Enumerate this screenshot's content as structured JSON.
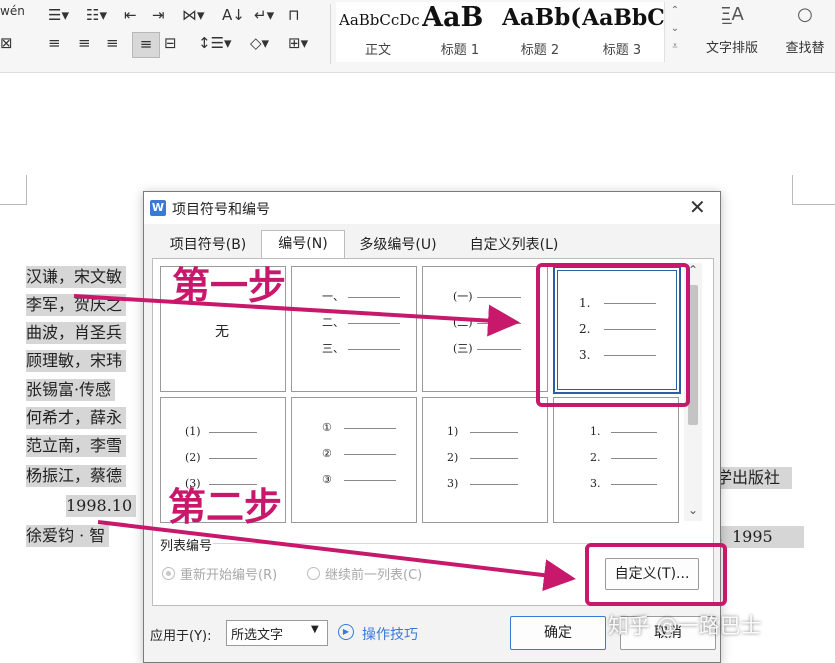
{
  "ribbon": {
    "font_label": "wén",
    "styles": [
      {
        "sample": "AaBbCcDc",
        "label": "正文"
      },
      {
        "sample": "AaB",
        "label": "标题 1"
      },
      {
        "sample": "AaBb(",
        "label": "标题 2"
      },
      {
        "sample": "AaBbC",
        "label": "标题 3"
      }
    ],
    "text_layout_label": "文字排版",
    "find_label": "查找替"
  },
  "document": {
    "lines": [
      "汉谦，宋文敏",
      "李军，贺庆之",
      "曲波，肖圣兵",
      "顾理敏，宋玮",
      "张锡富·传感",
      "何希才，薛永",
      "范立南，李雪",
      "杨振江，蔡德",
      "1998.10",
      "徐爱钧 · 智"
    ],
    "right_fragments": [
      "学出版社",
      "，1995"
    ]
  },
  "dialog": {
    "title": "项目符号和编号",
    "tabs": [
      "项目符号(B)",
      "编号(N)",
      "多级编号(U)",
      "自定义列表(L)"
    ],
    "active_tab": 1,
    "cells": [
      {
        "type": "none",
        "label": "无"
      },
      {
        "items": [
          "一、",
          "二、",
          "三、"
        ]
      },
      {
        "items": [
          "(一)",
          "(二)",
          "(三)"
        ]
      },
      {
        "items": [
          "1.",
          "2.",
          "3."
        ]
      },
      {
        "items": [
          "(1)",
          "(2)",
          "(3)"
        ]
      },
      {
        "items": [
          "①",
          "②",
          "③"
        ]
      },
      {
        "items": [
          "1)",
          "2)",
          "3)"
        ]
      },
      {
        "items": [
          "1.",
          "2.",
          "3."
        ]
      }
    ],
    "list_numbering_label": "列表编号",
    "restart_label": "重新开始编号(R)",
    "continue_label": "继续前一列表(C)",
    "customize_button": "自定义(T)...",
    "apply_to_label": "应用于(Y):",
    "apply_to_value": "所选文字",
    "tips_label": "操作技巧",
    "ok_button": "确定",
    "cancel_button": "取消"
  },
  "annotations": {
    "step1": "第一步",
    "step2": "第二步",
    "color": "#c7186b"
  },
  "watermark": "知乎 @一路巴士"
}
